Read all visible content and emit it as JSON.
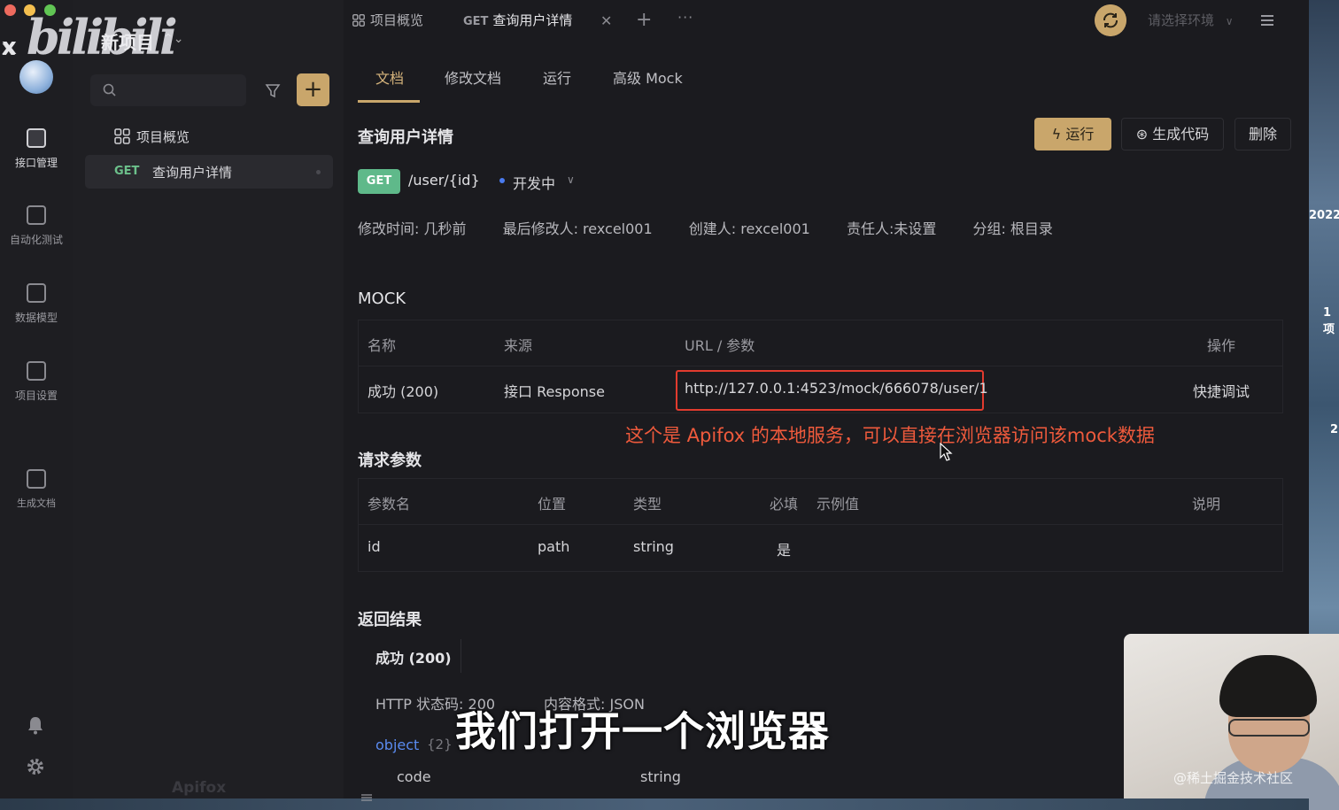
{
  "watermark": {
    "bilibili": "bilibili",
    "close": "x",
    "apifox": "Apifox",
    "juejin": "@稀土掘金技术社区"
  },
  "window": {
    "project_name": "新项目"
  },
  "rail": {
    "items": [
      {
        "label": "接口管理",
        "icon": "api-management-icon"
      },
      {
        "label": "自动化测试",
        "icon": "automation-test-icon"
      },
      {
        "label": "数据模型",
        "icon": "data-model-icon"
      },
      {
        "label": "项目设置",
        "icon": "project-settings-icon"
      },
      {
        "label": "生成文档",
        "icon": "generate-docs-icon"
      }
    ]
  },
  "sidebar": {
    "search_placeholder": "",
    "add_label": "+",
    "tree": {
      "overview": "项目概览",
      "api_method": "GET",
      "api_name": "查询用户详情"
    }
  },
  "tabs": {
    "overview": "项目概览",
    "api_method": "GET",
    "api_name": "查询用户详情",
    "close": "✕",
    "add": "+",
    "more": "···"
  },
  "env_select": {
    "placeholder": "请选择环境"
  },
  "subtabs": [
    "文档",
    "修改文档",
    "运行",
    "高级 Mock"
  ],
  "api": {
    "title": "查询用户详情",
    "method": "GET",
    "path": "/user/{id}",
    "status": "开发中",
    "buttons": {
      "run": "运行",
      "generate": "生成代码",
      "delete": "删除"
    },
    "meta": {
      "modified": "修改时间: 几秒前",
      "last_editor": "最后修改人: rexcel001",
      "creator": "创建人: rexcel001",
      "owner": "责任人:未设置",
      "group": "分组: 根目录"
    }
  },
  "mock": {
    "title": "MOCK",
    "headers": [
      "名称",
      "来源",
      "URL / 参数",
      "操作"
    ],
    "rows": [
      {
        "name": "成功 (200)",
        "source": "接口 Response",
        "url": "http://127.0.0.1:4523/mock/666078/user/1",
        "action": "快捷调试"
      }
    ],
    "annotation": "这个是 Apifox 的本地服务，可以直接在浏览器访问该mock数据"
  },
  "params": {
    "title": "请求参数",
    "headers": [
      "参数名",
      "位置",
      "类型",
      "必填",
      "示例值",
      "说明"
    ],
    "rows": [
      {
        "name": "id",
        "location": "path",
        "type": "string",
        "required": "是",
        "example": "",
        "desc": ""
      }
    ]
  },
  "response": {
    "title": "返回结果",
    "tab": "成功 (200)",
    "status": "HTTP 状态码: 200",
    "format": "内容格式: JSON",
    "object_type": "object",
    "object_count": "{2}",
    "fields": [
      {
        "name": "code",
        "type": "string"
      }
    ]
  },
  "subtitle": "我们打开一个浏览器",
  "desktop": {
    "texts": [
      "2022",
      "1 项",
      "2"
    ]
  },
  "colors": {
    "accent": "#c9a66b",
    "get": "#5fb98a",
    "annotation": "#ef5a3c",
    "highlight_box": "#e23b2e",
    "link": "#5a8bf0"
  }
}
